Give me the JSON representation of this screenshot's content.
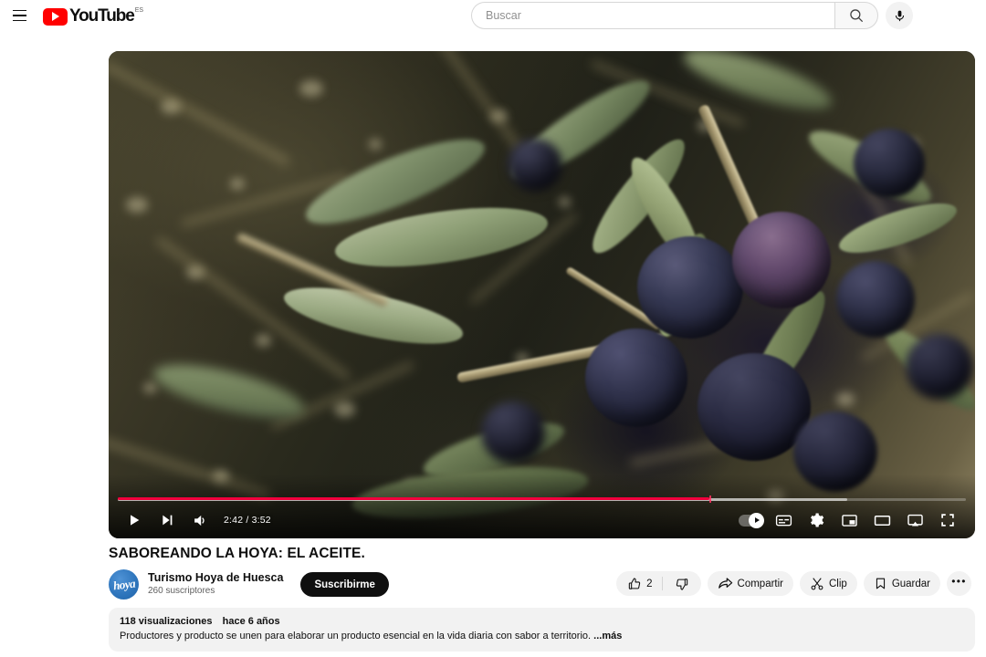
{
  "masthead": {
    "menu_icon": "hamburger-menu-icon",
    "logo_text": "YouTube",
    "logo_country": "ES",
    "search": {
      "value": "",
      "placeholder": "Buscar",
      "icon": "search-icon"
    },
    "mic_icon": "microphone-icon"
  },
  "player": {
    "current_time": "2:42",
    "total_time": "3:52",
    "time_display": "2:42 / 3:52",
    "progress_percent": 69.8,
    "buffered_percent": 86,
    "state": "paused",
    "controls_left": [
      {
        "name": "play-button",
        "icon": "play-icon"
      },
      {
        "name": "next-video-button",
        "icon": "next-track-icon"
      },
      {
        "name": "volume-button",
        "icon": "volume-icon"
      }
    ],
    "controls_right": [
      {
        "name": "autoplay-toggle",
        "icon": "autoplay-toggle-icon",
        "state": "on"
      },
      {
        "name": "subtitles-button",
        "icon": "subtitles-icon"
      },
      {
        "name": "settings-button",
        "icon": "gear-icon"
      },
      {
        "name": "miniplayer-button",
        "icon": "miniplayer-icon"
      },
      {
        "name": "theater-mode-button",
        "icon": "theater-mode-icon"
      },
      {
        "name": "cast-button",
        "icon": "cast-icon"
      },
      {
        "name": "fullscreen-button",
        "icon": "fullscreen-icon"
      }
    ]
  },
  "video": {
    "title": "SABOREANDO LA HOYA: EL ACEITE.",
    "channel": {
      "name": "Turismo Hoya de Huesca",
      "subscribers": "260 suscriptores",
      "avatar_text": "hoya",
      "avatar_color": "#2f76bd"
    },
    "subscribe_label": "Suscribirme",
    "actions": {
      "like_count": "2",
      "like_icon": "thumbs-up-icon",
      "dislike_icon": "thumbs-down-icon",
      "share_label": "Compartir",
      "share_icon": "share-arrow-icon",
      "clip_label": "Clip",
      "clip_icon": "scissors-icon",
      "save_label": "Guardar",
      "save_icon": "bookmark-icon",
      "more_label": "•••"
    },
    "description": {
      "views": "118 visualizaciones",
      "published": "hace 6 años",
      "text": "Productores y producto se unen para elaborar un producto esencial en la vida diaria con sabor a territorio.",
      "more_label": "...más"
    }
  },
  "colors": {
    "brand_red": "#ff0000",
    "progress_red": "#f0003c",
    "chip_gray": "#f2f2f2",
    "text_primary": "#0f0f0f",
    "text_secondary": "#606060"
  }
}
